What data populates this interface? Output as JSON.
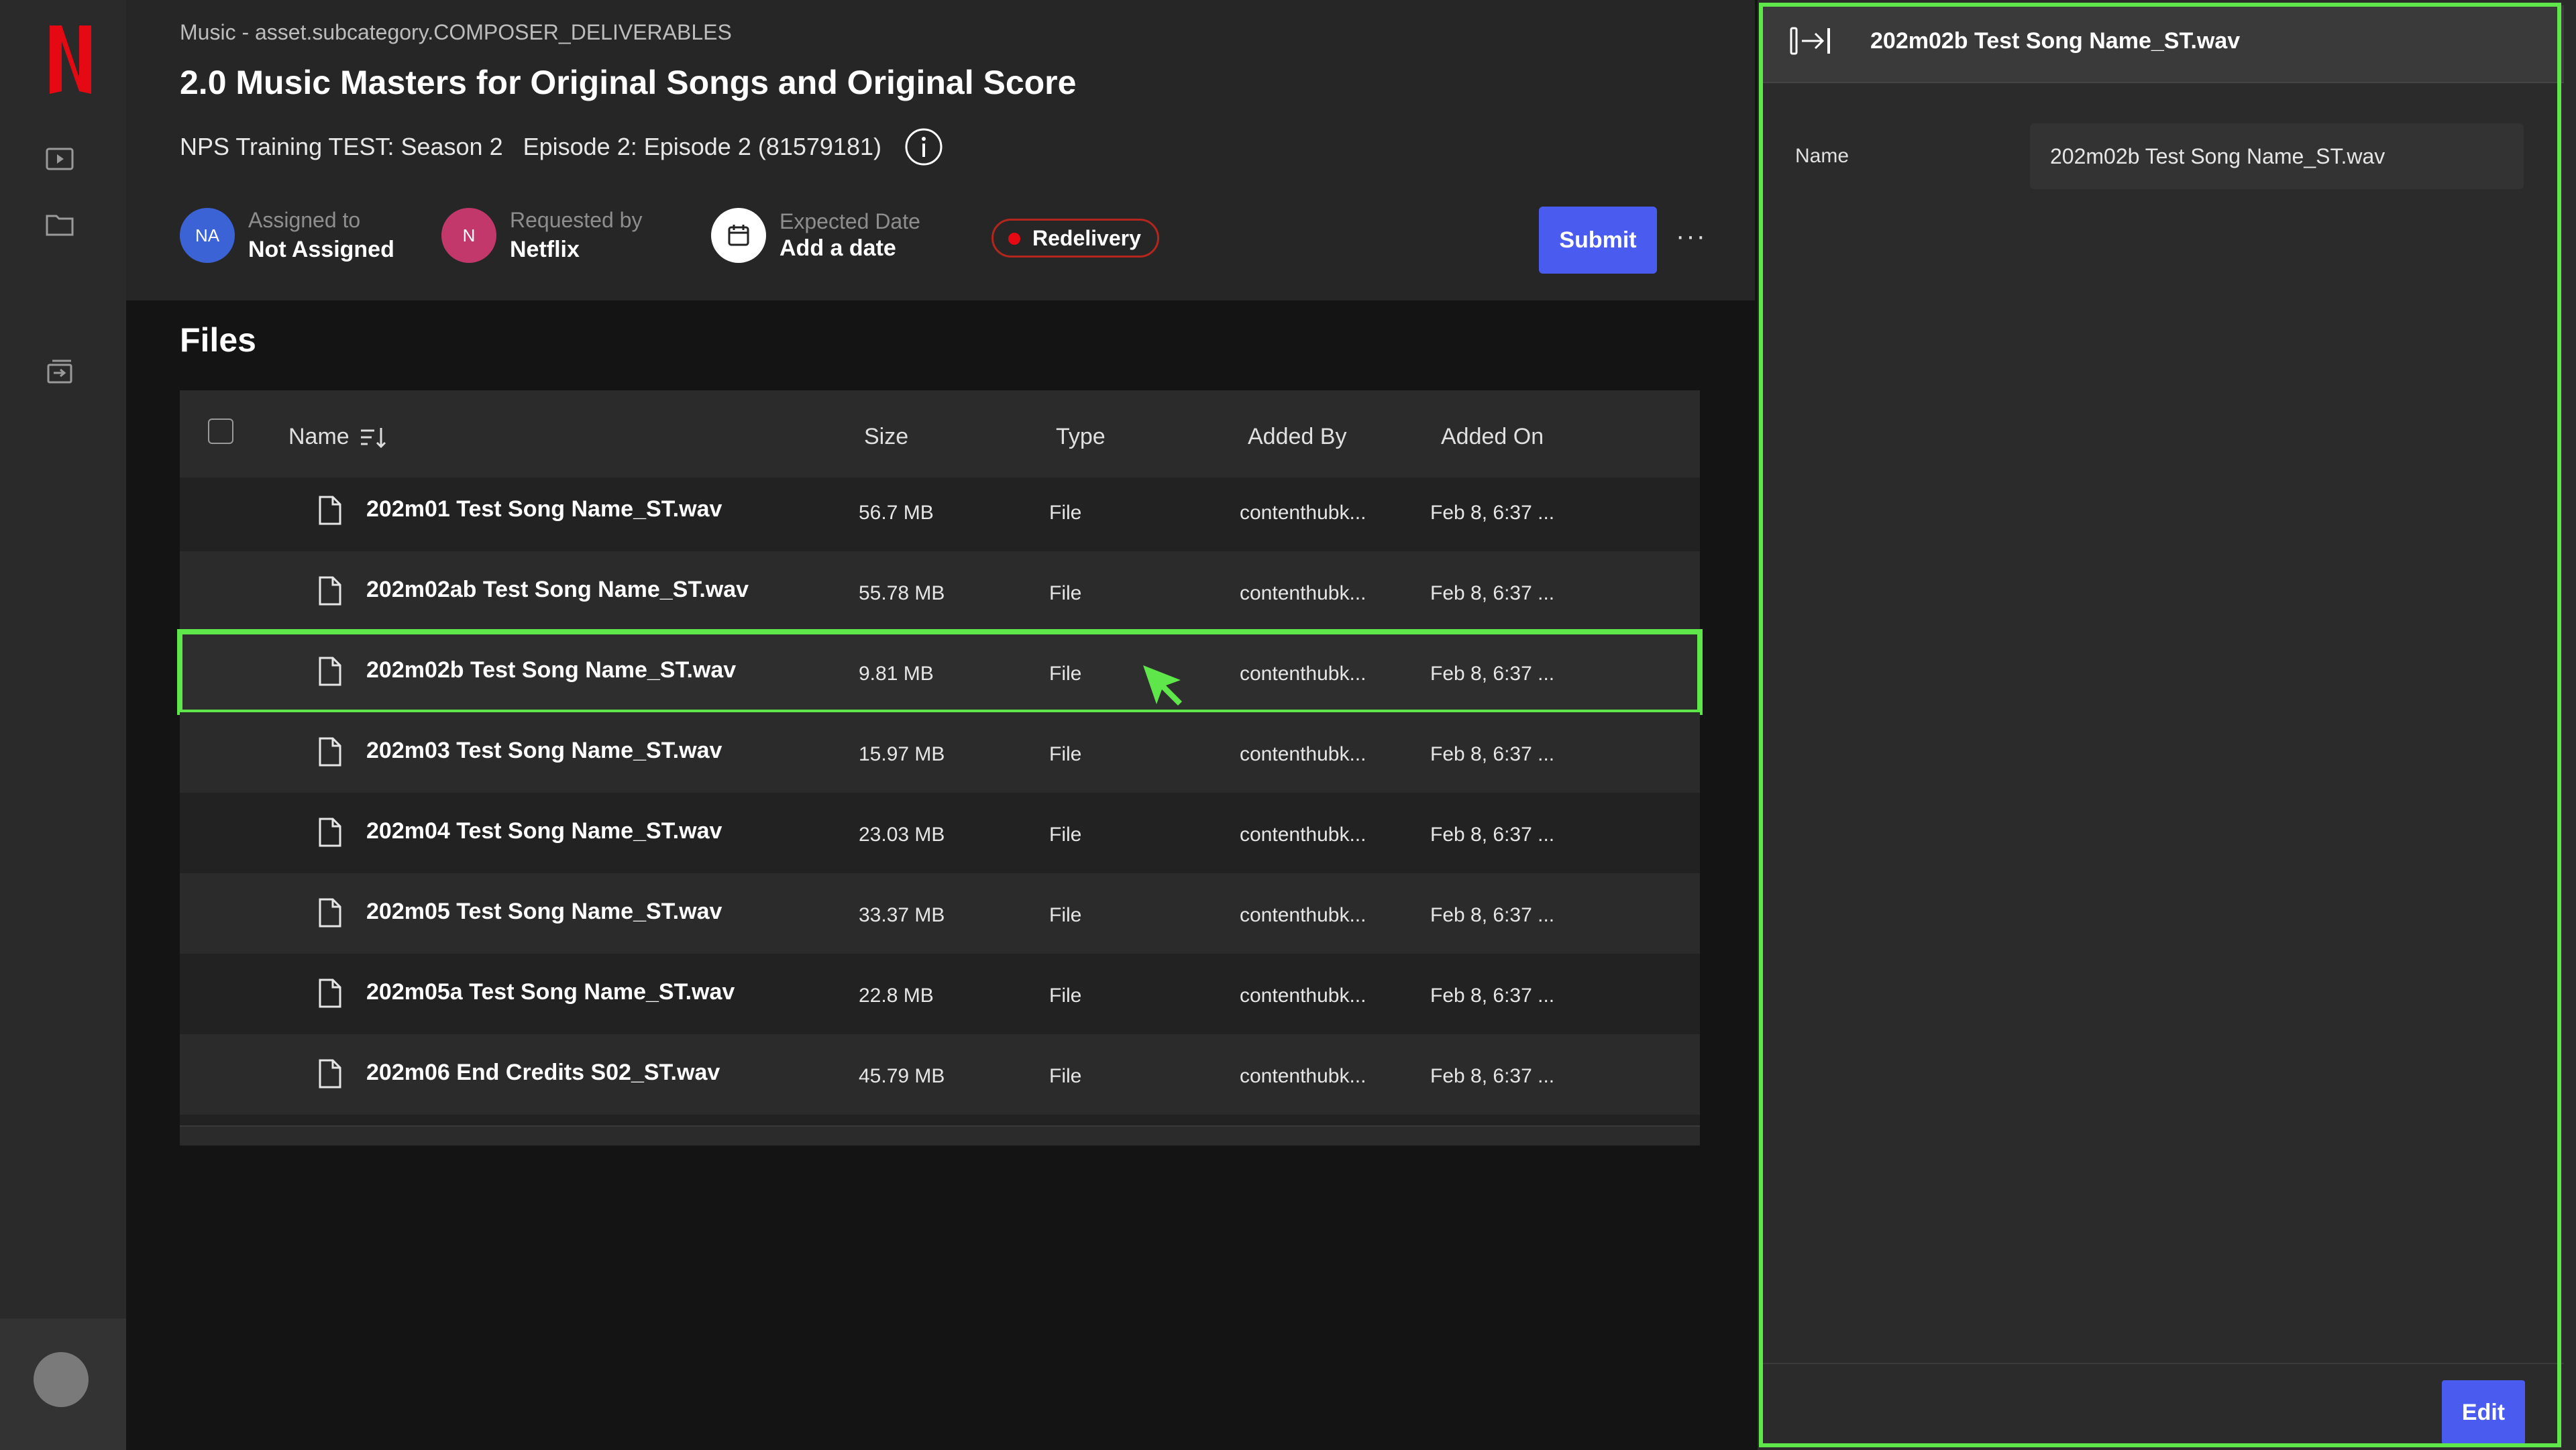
{
  "header": {
    "breadcrumb": "Music - asset.subcategory.COMPOSER_DELIVERABLES",
    "title": "2.0 Music Masters for Original Songs and Original Score",
    "show": "NPS Training TEST: Season 2",
    "episode": "Episode 2: Episode 2 (81579181)",
    "assigned": {
      "initials": "NA",
      "label": "Assigned to",
      "value": "Not Assigned"
    },
    "requested": {
      "initials": "N",
      "label": "Requested by",
      "value": "Netflix"
    },
    "expected": {
      "label": "Expected Date",
      "value": "Add a date"
    },
    "badge": "Redelivery",
    "submit_label": "Submit",
    "more_label": "···"
  },
  "files": {
    "title": "Files",
    "columns": {
      "name": "Name",
      "size": "Size",
      "type": "Type",
      "added_by": "Added By",
      "added_on": "Added On"
    },
    "rows": [
      {
        "name": "202m01 Test Song Name_ST.wav",
        "size": "56.7 MB",
        "type": "File",
        "added_by": "contenthubk...",
        "added_on": "Feb 8, 6:37 ..."
      },
      {
        "name": "202m02ab Test Song Name_ST.wav",
        "size": "55.78 MB",
        "type": "File",
        "added_by": "contenthubk...",
        "added_on": "Feb 8, 6:37 ..."
      },
      {
        "name": "202m02b Test Song Name_ST.wav",
        "size": "9.81 MB",
        "type": "File",
        "added_by": "contenthubk...",
        "added_on": "Feb 8, 6:37 ..."
      },
      {
        "name": "202m03 Test Song Name_ST.wav",
        "size": "15.97 MB",
        "type": "File",
        "added_by": "contenthubk...",
        "added_on": "Feb 8, 6:37 ..."
      },
      {
        "name": "202m04 Test Song Name_ST.wav",
        "size": "23.03 MB",
        "type": "File",
        "added_by": "contenthubk...",
        "added_on": "Feb 8, 6:37 ..."
      },
      {
        "name": "202m05 Test Song Name_ST.wav",
        "size": "33.37 MB",
        "type": "File",
        "added_by": "contenthubk...",
        "added_on": "Feb 8, 6:37 ..."
      },
      {
        "name": "202m05a Test Song Name_ST.wav",
        "size": "22.8 MB",
        "type": "File",
        "added_by": "contenthubk...",
        "added_on": "Feb 8, 6:37 ..."
      },
      {
        "name": "202m06 End Credits S02_ST.wav",
        "size": "45.79 MB",
        "type": "File",
        "added_by": "contenthubk...",
        "added_on": "Feb 8, 6:37 ..."
      }
    ]
  },
  "panel": {
    "title": "202m02b Test Song Name_ST.wav",
    "name_label": "Name",
    "name_value": "202m02b Test Song Name_ST.wav",
    "edit_label": "Edit"
  },
  "colors": {
    "accent": "#4a5bf0",
    "brand": "#e50914",
    "highlight": "#5ee64b",
    "badge_border": "#b3261e"
  },
  "icons": [
    "netflix-logo",
    "play-icon",
    "folder-icon",
    "tray-icon",
    "info-icon",
    "calendar-icon",
    "sort-icon",
    "file-icon",
    "collapse-panel-icon",
    "cursor-arrow"
  ]
}
